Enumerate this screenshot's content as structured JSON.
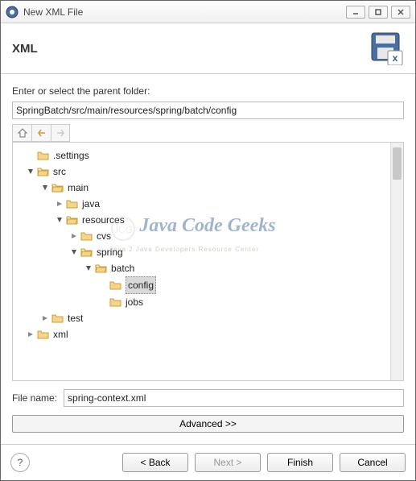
{
  "window": {
    "title": "New XML File"
  },
  "header": {
    "heading": "XML"
  },
  "labels": {
    "parentFolder": "Enter or select the parent folder:",
    "fileName": "File name:"
  },
  "inputs": {
    "parentFolderValue": "SpringBatch/src/main/resources/spring/batch/config",
    "fileNameValue": "spring-context.xml"
  },
  "buttons": {
    "advanced": "Advanced >>",
    "back": "< Back",
    "next": "Next >",
    "finish": "Finish",
    "cancel": "Cancel",
    "help": "?"
  },
  "tree": {
    "nodes": {
      "settings": ".settings",
      "src": "src",
      "main": "main",
      "java": "java",
      "resources": "resources",
      "cvs": "cvs",
      "spring": "spring",
      "batch": "batch",
      "config": "config",
      "jobs": "jobs",
      "test": "test",
      "xml": "xml"
    }
  },
  "watermark": {
    "line1": "Java Code Geeks",
    "line2": "Java 2 Java Developers Resource Center"
  }
}
